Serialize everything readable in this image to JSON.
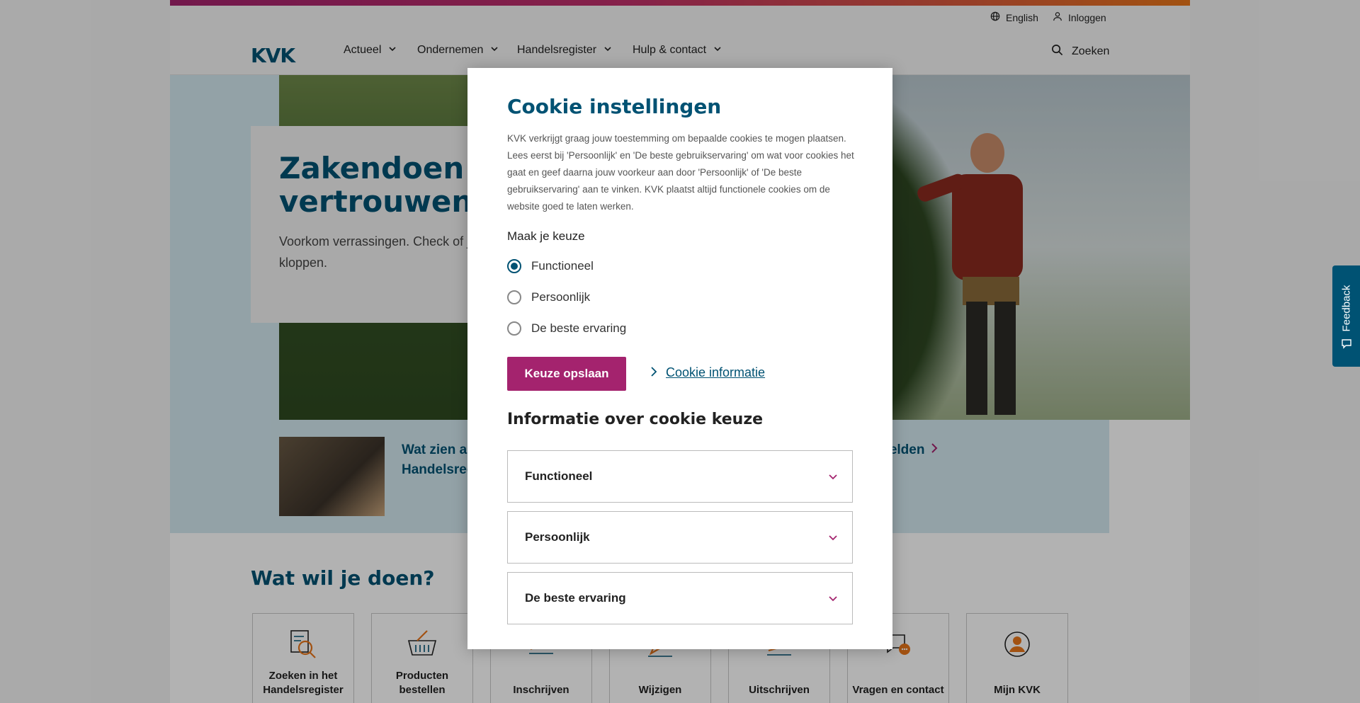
{
  "utility": {
    "language": "English",
    "login": "Inloggen"
  },
  "nav": {
    "logo": "KVK",
    "items": [
      "Actueel",
      "Ondernemen",
      "Handelsregister",
      "Hulp & contact"
    ],
    "search": "Zoeken"
  },
  "hero": {
    "title": "Zakendoen met vertrouwen",
    "text": "Voorkom verrassingen. Check of je eigen gegevens in het Handelsregister kloppen."
  },
  "teasers": {
    "first": "Wat zien anderen van jou in het Handelsregister?",
    "second": "Melden"
  },
  "section": {
    "title": "Wat wil je doen?"
  },
  "tiles": [
    {
      "label": "Zoeken in het Handelsregister",
      "icon": "search-register-icon"
    },
    {
      "label": "Producten bestellen",
      "icon": "basket-icon"
    },
    {
      "label": "Inschrijven",
      "icon": "register-icon"
    },
    {
      "label": "Wijzigen",
      "icon": "edit-icon"
    },
    {
      "label": "Uitschrijven",
      "icon": "deregister-icon"
    },
    {
      "label": "Vragen en contact",
      "icon": "chat-icon"
    },
    {
      "label": "Mijn KVK",
      "icon": "user-icon"
    }
  ],
  "feedback": "Feedback",
  "modal": {
    "title": "Cookie instellingen",
    "intro": "KVK verkrijgt graag jouw toestemming om bepaalde cookies te mogen plaatsen. Lees eerst bij 'Persoonlijk' en 'De beste gebruikservaring' om wat voor cookies het gaat en geef daarna jouw voorkeur aan door 'Persoonlijk' of 'De beste gebruikservaring' aan te vinken. KVK plaatst altijd functionele cookies om de website goed te laten werken.",
    "choice_label": "Maak je keuze",
    "options": [
      "Functioneel",
      "Persoonlijk",
      "De beste ervaring"
    ],
    "selected": "Functioneel",
    "save_button": "Keuze opslaan",
    "info_link": "Cookie informatie",
    "info_title": "Informatie over cookie keuze",
    "accordions": [
      "Functioneel",
      "Persoonlijk",
      "De beste ervaring"
    ]
  },
  "colors": {
    "brand": "#005273",
    "accent": "#a4236e",
    "orange": "#e8761a"
  }
}
